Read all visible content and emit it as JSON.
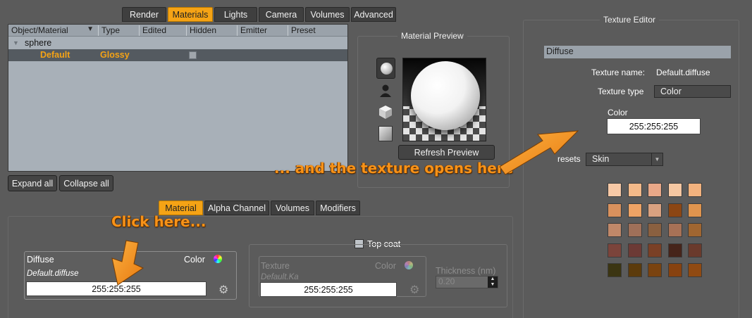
{
  "top_tabs": [
    "Render",
    "Materials",
    "Lights",
    "Camera",
    "Volumes",
    "Advanced"
  ],
  "outliner": {
    "columns": [
      "Object/Material",
      "Type",
      "Edited",
      "Hidden",
      "Emitter",
      "Preset"
    ],
    "object_name": "sphere",
    "material_name": "Default",
    "material_type": "Glossy"
  },
  "buttons": {
    "expand_all": "Expand all",
    "collapse_all": "Collapse all",
    "refresh_preview": "Refresh Preview"
  },
  "material_preview": {
    "title": "Material Preview"
  },
  "sub_tabs": [
    "Material",
    "Alpha Channel",
    "Volumes",
    "Modifiers"
  ],
  "diffuse": {
    "label": "Diffuse",
    "color_label": "Color",
    "texture": "Default.diffuse",
    "value": "255:255:255"
  },
  "top_coat": {
    "label": "Top coat",
    "texture_label": "Texture",
    "color_label": "Color",
    "texture": "Default.Ka",
    "value": "255:255:255",
    "thickness_label": "Thickness (nm)",
    "thickness_value": "0.20"
  },
  "texture_editor": {
    "title": "Texture Editor",
    "section": "Diffuse",
    "name_label": "Texture name:",
    "name_value": "Default.diffuse",
    "type_label": "Texture type",
    "type_value": "Color",
    "color_label": "Color",
    "color_value": "255:255:255",
    "presets_label": "resets",
    "presets_value": "Skin",
    "swatches": [
      "#f7c9a6",
      "#f3b989",
      "#e9a888",
      "#f5c7a2",
      "#f2b27e",
      "#d9915d",
      "#eea365",
      "#d9a180",
      "#8c4614",
      "#df944e",
      "#c08869",
      "#9f7059",
      "#8a6040",
      "#a77156",
      "#a06631",
      "#7b443b",
      "#6c3a35",
      "#7a4026",
      "#46241a",
      "#6a3a2c",
      "#3b3512",
      "#5c3b0c",
      "#7a4310",
      "#874210",
      "#904a12"
    ]
  },
  "callouts": {
    "click_here": "Click here...",
    "opens_here": "... and the texture opens here"
  },
  "colors": {
    "accent": "#f5a315",
    "callout": "#f79218"
  }
}
